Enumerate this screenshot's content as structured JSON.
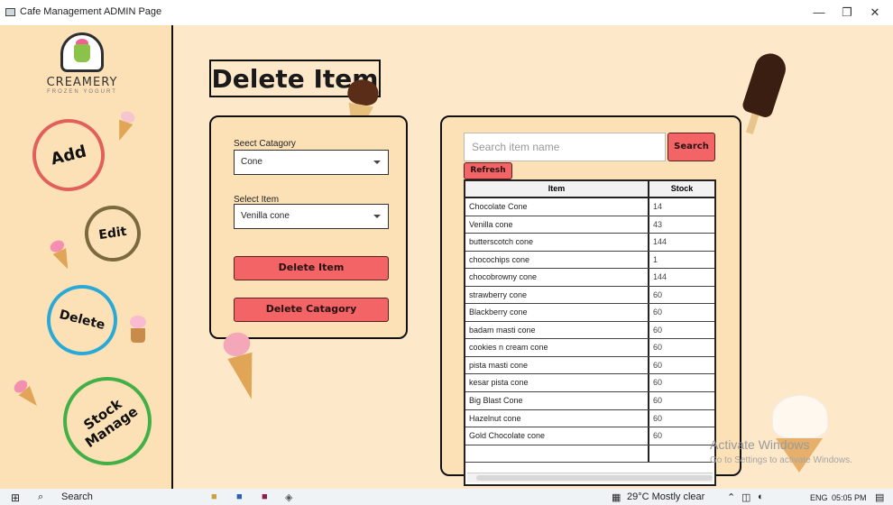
{
  "window": {
    "title": "Cafe Management ADMIN Page",
    "minimize": "—",
    "restore": "❐",
    "close": "✕"
  },
  "logo": {
    "name": "CREAMERY",
    "tagline": "FROZEN YOGURT"
  },
  "nav": {
    "add": "Add",
    "edit": "Edit",
    "delete": "Delete",
    "stock": "Stock",
    "manage": "Manage"
  },
  "page_title": "Delete Item",
  "form": {
    "category_label": "Seect Catagory",
    "category_value": "Cone",
    "item_label": "Select Item",
    "item_value": "Venilla cone",
    "delete_item_button": "Delete Item",
    "delete_category_button": "Delete Catagory"
  },
  "search": {
    "placeholder": "Search item name",
    "button": "Search",
    "refresh": "Refresh"
  },
  "table": {
    "headers": [
      "Item",
      "Stock"
    ],
    "rows": [
      [
        "Chocolate Cone",
        "14"
      ],
      [
        "Venilla cone",
        "43"
      ],
      [
        "butterscotch cone",
        "144"
      ],
      [
        "chocochips cone",
        "1"
      ],
      [
        "chocobrowny cone",
        "144"
      ],
      [
        "strawberry cone",
        "60"
      ],
      [
        "Blackberry cone",
        "60"
      ],
      [
        "badam masti cone",
        "60"
      ],
      [
        "cookies n cream cone",
        "60"
      ],
      [
        "pista masti cone",
        "60"
      ],
      [
        "kesar pista cone",
        "60"
      ],
      [
        "Big Blast Cone",
        "60"
      ],
      [
        "Hazelnut cone",
        "60"
      ],
      [
        "Gold Chocolate cone",
        "60"
      ]
    ]
  },
  "activation": {
    "title": "Activate Windows",
    "subtitle": "Go to Settings to activate Windows."
  },
  "taskbar": {
    "search": "Search",
    "weather": "29°C  Mostly clear",
    "language": "ENG",
    "time": "05:05 PM"
  },
  "colors": {
    "accent_red": "#f26466",
    "add_ring": "#e2605a",
    "edit_ring": "#7b6a3e",
    "delete_ring": "#2aa9d6",
    "stock_ring": "#43b047"
  }
}
